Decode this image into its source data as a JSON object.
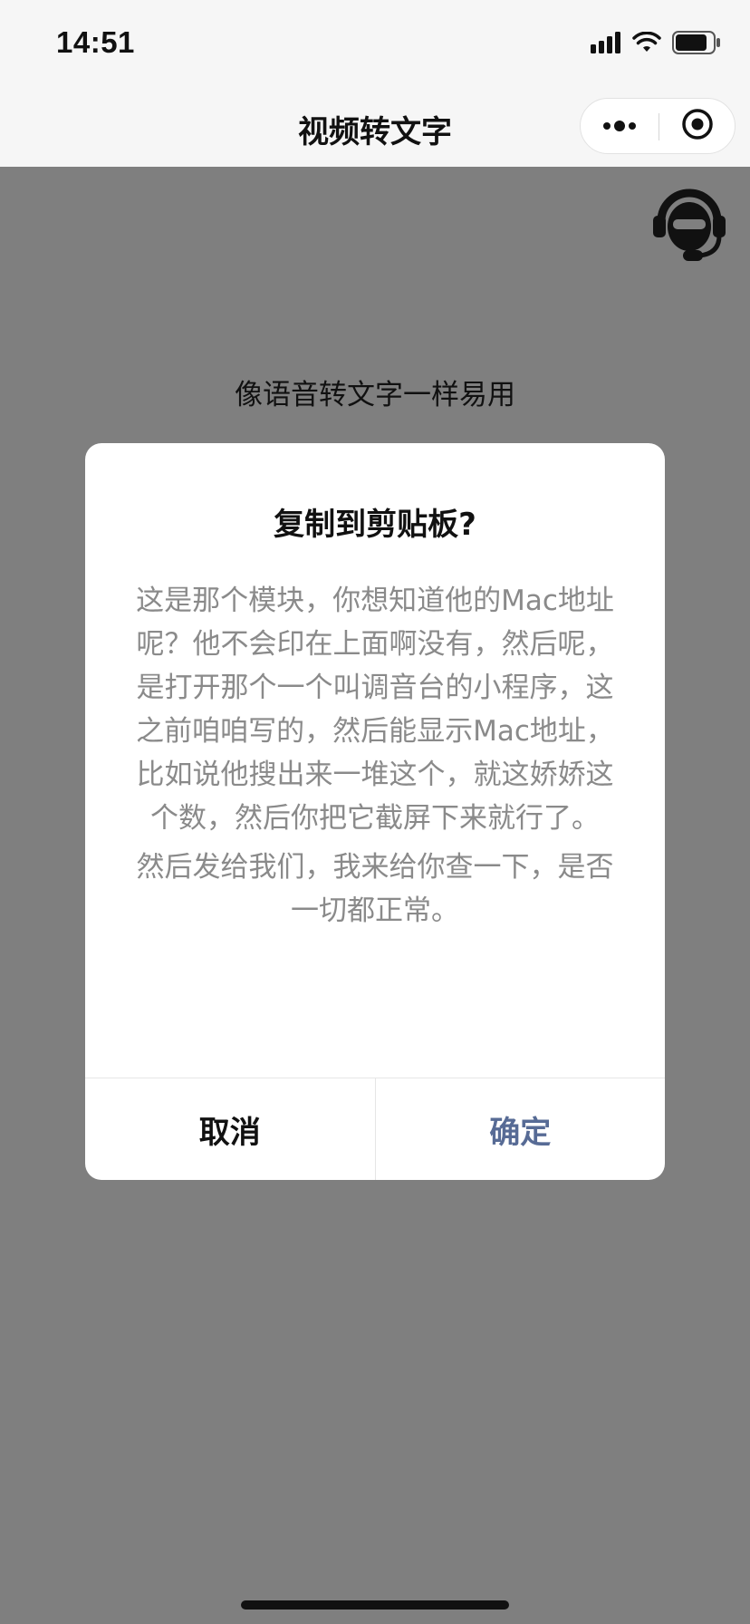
{
  "status_bar": {
    "time": "14:51",
    "icons": [
      "signal-icon",
      "wifi-icon",
      "battery-icon"
    ]
  },
  "nav": {
    "title": "视频转文字",
    "capsule_icons": [
      "more-icon",
      "close-miniprogram-icon"
    ]
  },
  "page": {
    "subtitle": "像语音转文字一样易用",
    "support_icon": "customer-service-icon"
  },
  "modal": {
    "title": "复制到剪贴板?",
    "paragraph1": "这是那个模块，你想知道他的Mac地址呢？他不会印在上面啊没有，然后呢，是打开那个一个叫调音台的小程序，这之前咱咱写的，然后能显示Mac地址，比如说他搜出来一堆这个，就这娇娇这个数，然后你把它截屏下来就行了。",
    "paragraph2": "然后发给我们，我来给你查一下，是否一切都正常。",
    "cancel_label": "取消",
    "confirm_label": "确定"
  },
  "colors": {
    "overlay": "#7f7f7f",
    "confirm_text": "#576b95",
    "modal_body_text": "#8a8a8a"
  }
}
